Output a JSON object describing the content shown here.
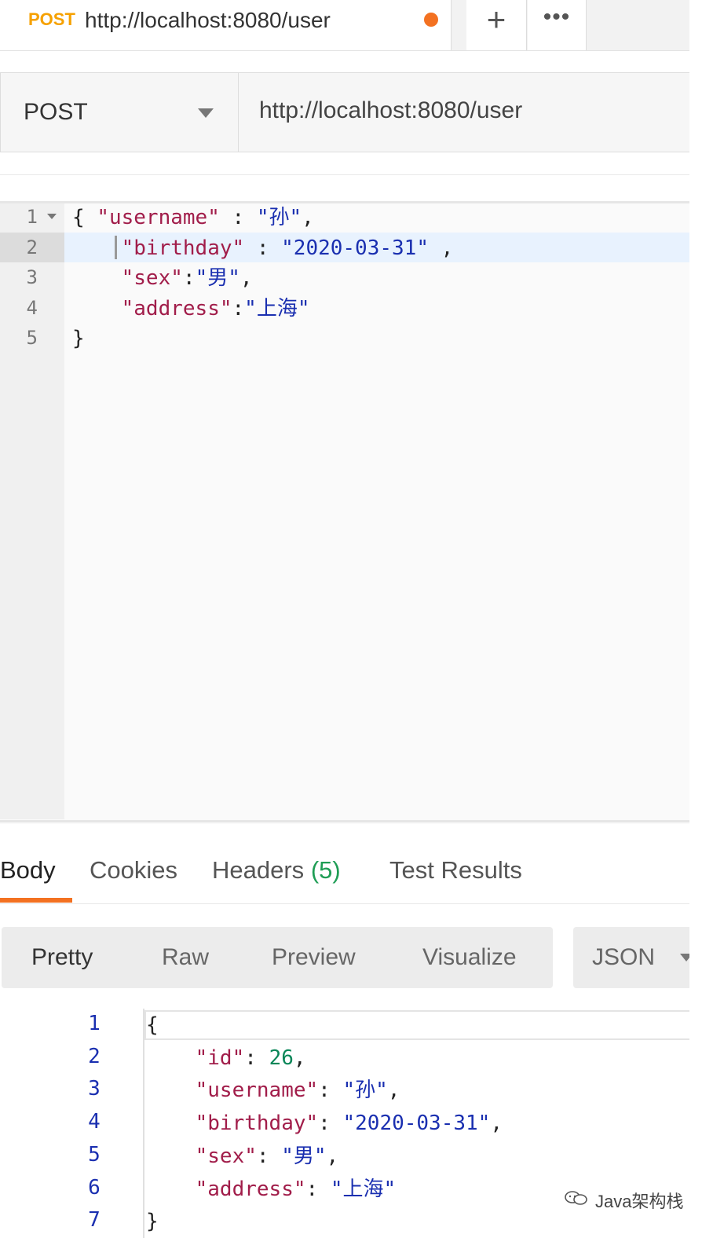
{
  "request_tab": {
    "method": "POST",
    "url": "http://localhost:8080/user",
    "new_tab": "+",
    "more": "•••"
  },
  "request_bar": {
    "method": "POST",
    "url": "http://localhost:8080/user"
  },
  "request_body": {
    "line_numbers": [
      "1",
      "2",
      "3",
      "4",
      "5"
    ],
    "lines": [
      [
        [
          "p",
          "{ "
        ],
        [
          "k",
          "\"username\""
        ],
        [
          "p",
          " : "
        ],
        [
          "s",
          "\"孙\""
        ],
        [
          "p",
          ","
        ]
      ],
      [
        [
          "p",
          "    "
        ],
        [
          "k",
          "\"birthday\""
        ],
        [
          "p",
          " : "
        ],
        [
          "s",
          "\"2020-03-31\""
        ],
        [
          "p",
          " ,"
        ]
      ],
      [
        [
          "p",
          "    "
        ],
        [
          "k",
          "\"sex\""
        ],
        [
          "p",
          ":"
        ],
        [
          "s",
          "\"男\""
        ],
        [
          "p",
          ","
        ]
      ],
      [
        [
          "p",
          "    "
        ],
        [
          "k",
          "\"address\""
        ],
        [
          "p",
          ":"
        ],
        [
          "s",
          "\"上海\""
        ]
      ],
      [
        [
          "p",
          "}"
        ]
      ]
    ]
  },
  "response_tabs": {
    "body": "Body",
    "cookies": "Cookies",
    "headers": "Headers",
    "headers_count": "(5)",
    "test_results": "Test Results"
  },
  "format_bar": {
    "pretty": "Pretty",
    "raw": "Raw",
    "preview": "Preview",
    "visualize": "Visualize",
    "type": "JSON"
  },
  "response_body": {
    "line_numbers": [
      "1",
      "2",
      "3",
      "4",
      "5",
      "6",
      "7"
    ],
    "lines": [
      [
        [
          "p",
          "{"
        ]
      ],
      [
        [
          "p",
          "    "
        ],
        [
          "k",
          "\"id\""
        ],
        [
          "p",
          ": "
        ],
        [
          "n",
          "26"
        ],
        [
          "p",
          ","
        ]
      ],
      [
        [
          "p",
          "    "
        ],
        [
          "k",
          "\"username\""
        ],
        [
          "p",
          ": "
        ],
        [
          "s",
          "\"孙\""
        ],
        [
          "p",
          ","
        ]
      ],
      [
        [
          "p",
          "    "
        ],
        [
          "k",
          "\"birthday\""
        ],
        [
          "p",
          ": "
        ],
        [
          "s",
          "\"2020-03-31\""
        ],
        [
          "p",
          ","
        ]
      ],
      [
        [
          "p",
          "    "
        ],
        [
          "k",
          "\"sex\""
        ],
        [
          "p",
          ": "
        ],
        [
          "s",
          "\"男\""
        ],
        [
          "p",
          ","
        ]
      ],
      [
        [
          "p",
          "    "
        ],
        [
          "k",
          "\"address\""
        ],
        [
          "p",
          ": "
        ],
        [
          "s",
          "\"上海\""
        ]
      ],
      [
        [
          "p",
          "}"
        ]
      ]
    ]
  },
  "watermark": "Java架构栈",
  "colors": {
    "accent_orange": "#f37121",
    "method_yellow": "#f6a100",
    "key": "#a11d4a",
    "string": "#1a2fb0",
    "number": "#098658",
    "count_green": "#1f9d55"
  }
}
